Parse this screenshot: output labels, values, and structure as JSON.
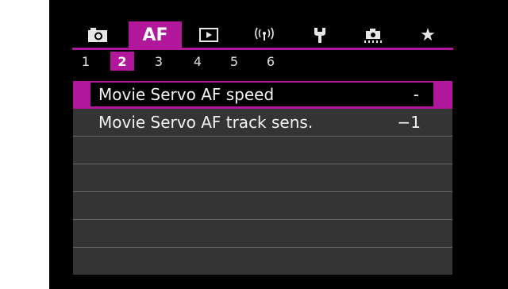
{
  "tabs": {
    "camera_icon": "camera-icon",
    "af_label": "AF",
    "play_icon": "playback-icon",
    "wireless_icon": "wireless-icon",
    "setup_icon": "wrench-icon",
    "custom_icon": "custom-functions-icon",
    "mymenu_icon": "star-icon"
  },
  "subtabs": [
    "1",
    "2",
    "3",
    "4",
    "5",
    "6"
  ],
  "menu": {
    "items": [
      {
        "label": "Movie Servo AF speed",
        "value": "-"
      },
      {
        "label": "Movie Servo AF track sens.",
        "value": "−1"
      },
      {
        "label": "",
        "value": ""
      },
      {
        "label": "",
        "value": ""
      },
      {
        "label": "",
        "value": ""
      },
      {
        "label": "",
        "value": ""
      },
      {
        "label": "",
        "value": ""
      }
    ]
  },
  "colors": {
    "accent": "#b0179b",
    "row_bg": "#343434",
    "screen_bg": "#000000"
  }
}
